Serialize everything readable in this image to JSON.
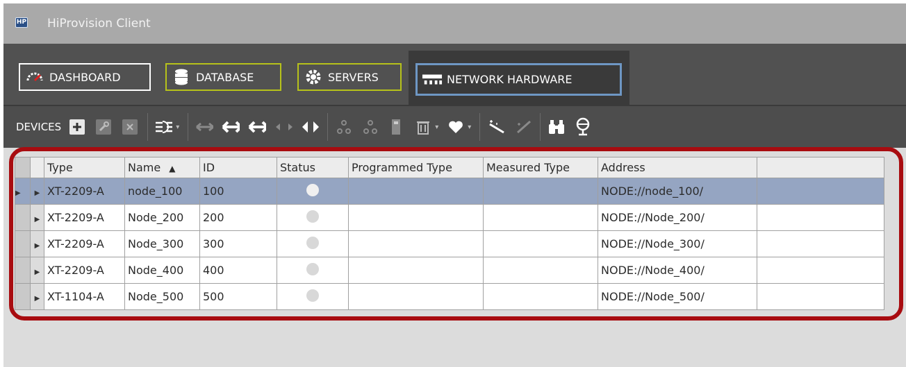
{
  "window": {
    "title": "HiProvision Client",
    "logo_text": "HP"
  },
  "nav": {
    "dashboard": "DASHBOARD",
    "database": "DATABASE",
    "servers": "SERVERS",
    "network_hardware": "NETWORK HARDWARE"
  },
  "toolbar": {
    "label": "DEVICES",
    "buttons": [
      "add-icon",
      "wrench-icon",
      "delete-icon",
      "columns-icon",
      "arrows-horizontal-icon",
      "arrows-bold-icon",
      "arrows-double-icon",
      "arrows-inward-icon",
      "arrows-outward-icon",
      "nodes-add-icon",
      "nodes-remove-icon",
      "device-icon",
      "trash-icon",
      "heart-icon",
      "wand-icon",
      "wand-disabled-icon",
      "binoculars-icon",
      "microphone-icon"
    ]
  },
  "grid": {
    "columns": [
      "Type",
      "Name",
      "ID",
      "Status",
      "Programmed Type",
      "Measured Type",
      "Address"
    ],
    "rows": [
      {
        "type": "XT-2209-A",
        "name": "node_100",
        "id": "100",
        "programmed": "",
        "measured": "",
        "address": "NODE://node_100/"
      },
      {
        "type": "XT-2209-A",
        "name": "Node_200",
        "id": "200",
        "programmed": "",
        "measured": "",
        "address": "NODE://Node_200/"
      },
      {
        "type": "XT-2209-A",
        "name": "Node_300",
        "id": "300",
        "programmed": "",
        "measured": "",
        "address": "NODE://Node_300/"
      },
      {
        "type": "XT-2209-A",
        "name": "Node_400",
        "id": "400",
        "programmed": "",
        "measured": "",
        "address": "NODE://Node_400/"
      },
      {
        "type": "XT-1104-A",
        "name": "Node_500",
        "id": "500",
        "programmed": "",
        "measured": "",
        "address": "NODE://Node_500/"
      }
    ]
  },
  "colors": {
    "accent": "#b7c21a",
    "active_tab_border": "#6e97c4",
    "selection": "#95a5c2",
    "highlight": "#a80c10"
  }
}
